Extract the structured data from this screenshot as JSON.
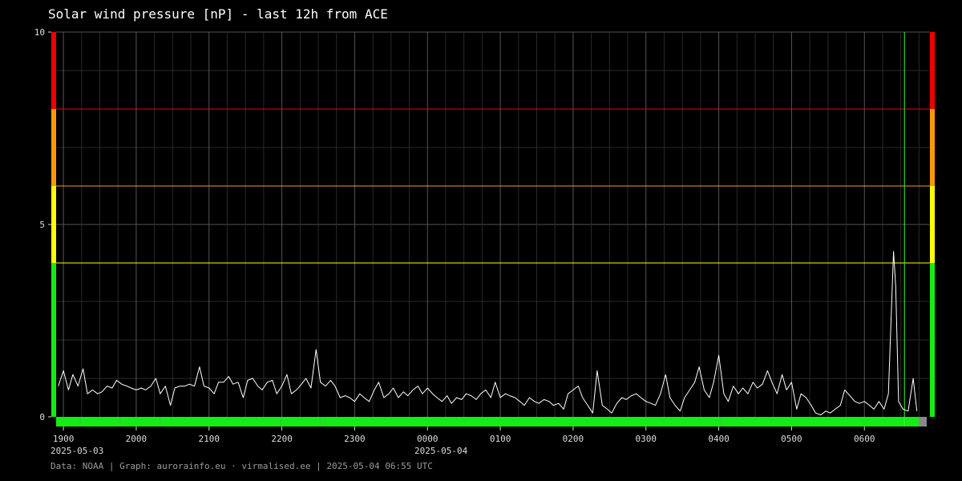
{
  "title": "Solar wind pressure [nP] - last 12h from ACE",
  "footer": "Data: NOAA | Graph: aurorainfo.eu · virmalised.ee | 2025-05-04 06:55 UTC",
  "dates": [
    "2025-05-03",
    "2025-05-04"
  ],
  "colors": {
    "background": "#000000",
    "grid_major": "#555555",
    "grid_minor": "#2a2a2a",
    "line": "#ffffff",
    "marker": "#33ff33",
    "green": "#11ee11",
    "yellow": "#ffff00",
    "orange": "#ff9900",
    "red": "#ee0000",
    "data_gap": "#888888"
  },
  "chart_data": {
    "type": "line",
    "title": "Solar wind pressure [nP] - last 12h from ACE",
    "xlabel": "",
    "ylabel": "",
    "ylim": [
      0,
      10
    ],
    "y_ticks": [
      0,
      5,
      10
    ],
    "xlim_hours": [
      18.9,
      6.9
    ],
    "x_tick_labels": [
      "1900",
      "2000",
      "2100",
      "2200",
      "2300",
      "0000",
      "0100",
      "0200",
      "0300",
      "0400",
      "0500",
      "0600"
    ],
    "x_tick_hours": [
      19,
      20,
      21,
      22,
      23,
      24,
      25,
      26,
      27,
      28,
      29,
      30
    ],
    "thresholds": [
      {
        "level": "green",
        "from": 0,
        "to": 4
      },
      {
        "level": "yellow",
        "from": 4,
        "to": 6
      },
      {
        "level": "orange",
        "from": 6,
        "to": 8
      },
      {
        "level": "red",
        "from": 8,
        "to": 10
      }
    ],
    "current_time_marker": "0633",
    "grid": true,
    "series": [
      {
        "x_start": "1900",
        "x_end": "0643",
        "points": [
          [
            18.93,
            0.8
          ],
          [
            19.0,
            1.2
          ],
          [
            19.07,
            0.7
          ],
          [
            19.13,
            1.1
          ],
          [
            19.2,
            0.8
          ],
          [
            19.27,
            1.25
          ],
          [
            19.33,
            0.6
          ],
          [
            19.4,
            0.7
          ],
          [
            19.47,
            0.6
          ],
          [
            19.53,
            0.65
          ],
          [
            19.6,
            0.8
          ],
          [
            19.67,
            0.75
          ],
          [
            19.73,
            0.95
          ],
          [
            19.8,
            0.85
          ],
          [
            19.87,
            0.8
          ],
          [
            19.93,
            0.75
          ],
          [
            20.0,
            0.7
          ],
          [
            20.07,
            0.75
          ],
          [
            20.13,
            0.7
          ],
          [
            20.2,
            0.8
          ],
          [
            20.27,
            1.0
          ],
          [
            20.33,
            0.6
          ],
          [
            20.4,
            0.8
          ],
          [
            20.47,
            0.3
          ],
          [
            20.53,
            0.75
          ],
          [
            20.6,
            0.8
          ],
          [
            20.67,
            0.8
          ],
          [
            20.73,
            0.85
          ],
          [
            20.8,
            0.8
          ],
          [
            20.87,
            1.3
          ],
          [
            20.93,
            0.8
          ],
          [
            21.0,
            0.75
          ],
          [
            21.07,
            0.6
          ],
          [
            21.13,
            0.9
          ],
          [
            21.2,
            0.9
          ],
          [
            21.27,
            1.05
          ],
          [
            21.33,
            0.85
          ],
          [
            21.4,
            0.9
          ],
          [
            21.47,
            0.5
          ],
          [
            21.53,
            0.95
          ],
          [
            21.6,
            1.0
          ],
          [
            21.67,
            0.8
          ],
          [
            21.73,
            0.7
          ],
          [
            21.8,
            0.9
          ],
          [
            21.87,
            0.95
          ],
          [
            21.93,
            0.6
          ],
          [
            22.0,
            0.8
          ],
          [
            22.07,
            1.1
          ],
          [
            22.13,
            0.6
          ],
          [
            22.2,
            0.7
          ],
          [
            22.27,
            0.85
          ],
          [
            22.33,
            1.0
          ],
          [
            22.4,
            0.75
          ],
          [
            22.47,
            1.75
          ],
          [
            22.53,
            0.9
          ],
          [
            22.6,
            0.8
          ],
          [
            22.67,
            0.95
          ],
          [
            22.73,
            0.8
          ],
          [
            22.8,
            0.5
          ],
          [
            22.87,
            0.55
          ],
          [
            22.93,
            0.5
          ],
          [
            23.0,
            0.4
          ],
          [
            23.07,
            0.6
          ],
          [
            23.13,
            0.5
          ],
          [
            23.2,
            0.4
          ],
          [
            23.27,
            0.7
          ],
          [
            23.33,
            0.9
          ],
          [
            23.4,
            0.5
          ],
          [
            23.47,
            0.6
          ],
          [
            23.53,
            0.75
          ],
          [
            23.6,
            0.5
          ],
          [
            23.67,
            0.65
          ],
          [
            23.73,
            0.55
          ],
          [
            23.8,
            0.7
          ],
          [
            23.87,
            0.8
          ],
          [
            23.93,
            0.6
          ],
          [
            24.0,
            0.75
          ],
          [
            24.07,
            0.6
          ],
          [
            24.13,
            0.5
          ],
          [
            24.2,
            0.4
          ],
          [
            24.27,
            0.55
          ],
          [
            24.33,
            0.35
          ],
          [
            24.4,
            0.5
          ],
          [
            24.47,
            0.45
          ],
          [
            24.53,
            0.6
          ],
          [
            24.6,
            0.55
          ],
          [
            24.67,
            0.45
          ],
          [
            24.73,
            0.6
          ],
          [
            24.8,
            0.7
          ],
          [
            24.87,
            0.5
          ],
          [
            24.93,
            0.9
          ],
          [
            25.0,
            0.5
          ],
          [
            25.07,
            0.6
          ],
          [
            25.13,
            0.55
          ],
          [
            25.2,
            0.5
          ],
          [
            25.27,
            0.4
          ],
          [
            25.33,
            0.3
          ],
          [
            25.4,
            0.5
          ],
          [
            25.47,
            0.4
          ],
          [
            25.53,
            0.35
          ],
          [
            25.6,
            0.45
          ],
          [
            25.67,
            0.4
          ],
          [
            25.73,
            0.3
          ],
          [
            25.8,
            0.35
          ],
          [
            25.87,
            0.2
          ],
          [
            25.93,
            0.6
          ],
          [
            26.0,
            0.7
          ],
          [
            26.07,
            0.8
          ],
          [
            26.13,
            0.5
          ],
          [
            26.2,
            0.3
          ],
          [
            26.27,
            0.1
          ],
          [
            26.33,
            1.2
          ],
          [
            26.4,
            0.3
          ],
          [
            26.47,
            0.2
          ],
          [
            26.53,
            0.1
          ],
          [
            26.6,
            0.35
          ],
          [
            26.67,
            0.5
          ],
          [
            26.73,
            0.45
          ],
          [
            26.8,
            0.55
          ],
          [
            26.87,
            0.6
          ],
          [
            26.93,
            0.5
          ],
          [
            27.0,
            0.4
          ],
          [
            27.07,
            0.35
          ],
          [
            27.13,
            0.3
          ],
          [
            27.2,
            0.6
          ],
          [
            27.27,
            1.1
          ],
          [
            27.33,
            0.5
          ],
          [
            27.4,
            0.3
          ],
          [
            27.47,
            0.15
          ],
          [
            27.53,
            0.5
          ],
          [
            27.6,
            0.7
          ],
          [
            27.67,
            0.9
          ],
          [
            27.73,
            1.3
          ],
          [
            27.8,
            0.7
          ],
          [
            27.87,
            0.5
          ],
          [
            27.93,
            0.9
          ],
          [
            28.0,
            1.6
          ],
          [
            28.07,
            0.6
          ],
          [
            28.13,
            0.4
          ],
          [
            28.2,
            0.8
          ],
          [
            28.27,
            0.6
          ],
          [
            28.33,
            0.75
          ],
          [
            28.4,
            0.6
          ],
          [
            28.47,
            0.9
          ],
          [
            28.53,
            0.75
          ],
          [
            28.6,
            0.85
          ],
          [
            28.67,
            1.2
          ],
          [
            28.73,
            0.9
          ],
          [
            28.8,
            0.6
          ],
          [
            28.87,
            1.1
          ],
          [
            28.93,
            0.7
          ],
          [
            29.0,
            0.9
          ],
          [
            29.07,
            0.2
          ],
          [
            29.13,
            0.6
          ],
          [
            29.2,
            0.5
          ],
          [
            29.27,
            0.3
          ],
          [
            29.33,
            0.1
          ],
          [
            29.4,
            0.05
          ],
          [
            29.47,
            0.15
          ],
          [
            29.53,
            0.1
          ],
          [
            29.6,
            0.2
          ],
          [
            29.67,
            0.3
          ],
          [
            29.73,
            0.7
          ],
          [
            29.8,
            0.55
          ],
          [
            29.87,
            0.4
          ],
          [
            29.93,
            0.35
          ],
          [
            30.0,
            0.4
          ],
          [
            30.07,
            0.3
          ],
          [
            30.13,
            0.2
          ],
          [
            30.2,
            0.4
          ],
          [
            30.27,
            0.2
          ],
          [
            30.33,
            0.6
          ],
          [
            30.4,
            4.3
          ],
          [
            30.43,
            3.4
          ],
          [
            30.47,
            0.4
          ],
          [
            30.53,
            0.2
          ],
          [
            30.6,
            0.15
          ],
          [
            30.67,
            1.0
          ],
          [
            30.72,
            0.15
          ]
        ]
      }
    ]
  }
}
